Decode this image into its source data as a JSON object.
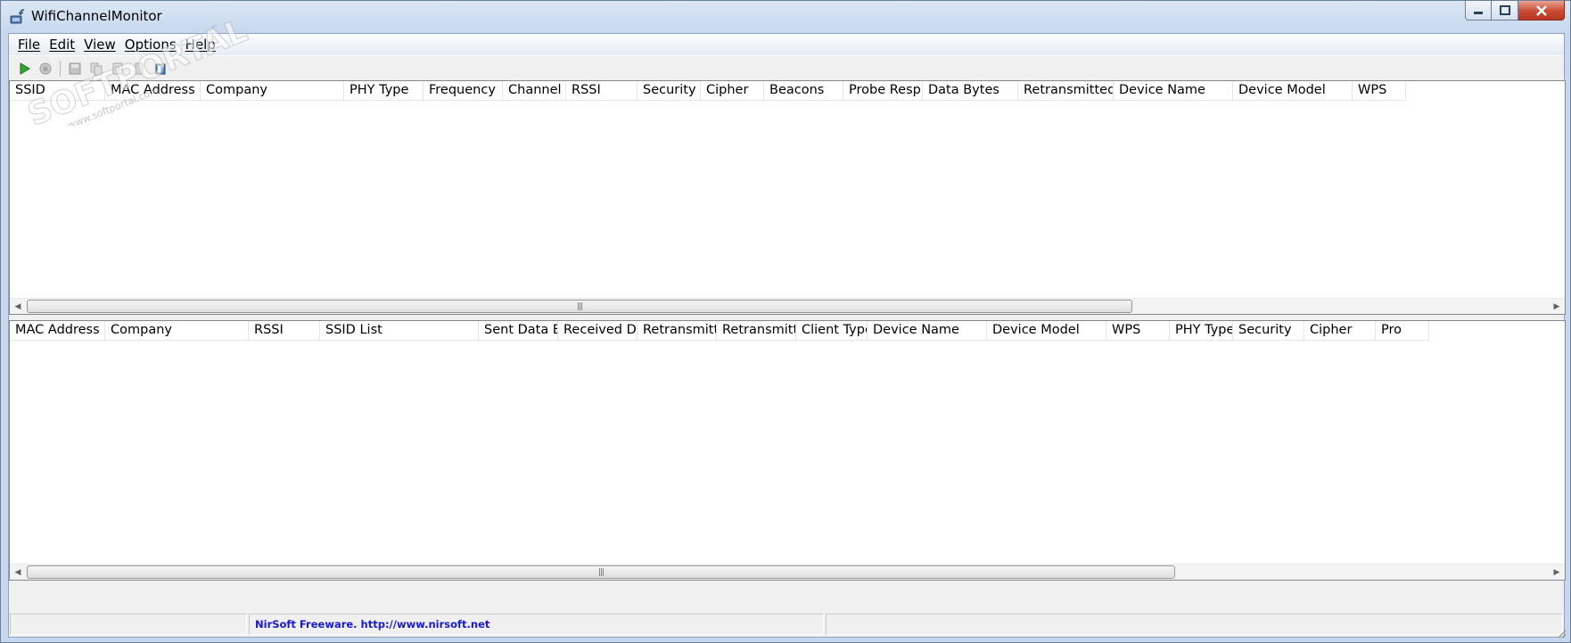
{
  "window": {
    "title": "WifiChannelMonitor",
    "icon": "wifi-monitor-app-icon"
  },
  "menu": [
    "File",
    "Edit",
    "View",
    "Options",
    "Help"
  ],
  "toolbar": {
    "buttons": [
      "start-icon",
      "stop-icon",
      "save-icon",
      "copy-icon",
      "properties-icon",
      "refresh-icon",
      "about-icon"
    ]
  },
  "access_points_list": {
    "columns": [
      "SSID",
      "MAC Address",
      "Company",
      "PHY Type",
      "Frequency",
      "Channel",
      "RSSI",
      "Security",
      "Cipher",
      "Beacons",
      "Probe Resp...",
      "Data Bytes",
      "Retransmitted ...",
      "Device Name",
      "Device Model",
      "WPS"
    ],
    "rows": []
  },
  "clients_list": {
    "columns": [
      "MAC Address",
      "Company",
      "RSSI",
      "SSID List",
      "Sent Data B...",
      "Received D...",
      "Retransmitt...",
      "Retransmitt...",
      "Client Type",
      "Device Name",
      "Device Model",
      "WPS",
      "PHY Type",
      "Security",
      "Cipher",
      "Pro"
    ],
    "rows": []
  },
  "statusbar": {
    "pane1": "",
    "link": "NirSoft Freeware.  http://www.nirsoft.net",
    "pane3": ""
  },
  "watermark": {
    "text": "SOFTPORTAL",
    "url": "www.softportal.com",
    "mark": "™"
  },
  "colors": {
    "accent_link": "#1a1ad1",
    "close_button": "#c94a33"
  }
}
